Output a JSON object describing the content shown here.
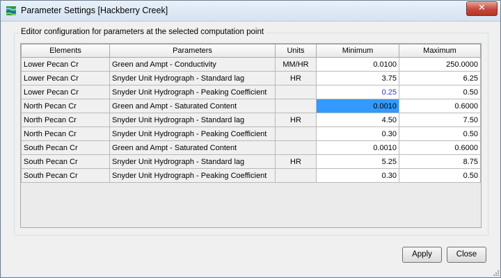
{
  "window": {
    "title": "Parameter Settings [Hackberry Creek]"
  },
  "group": {
    "label": "Editor configuration for parameters at the selected computation point"
  },
  "table": {
    "headers": [
      "Elements",
      "Parameters",
      "Units",
      "Minimum",
      "Maximum"
    ],
    "rows": [
      {
        "element": "Lower Pecan Cr",
        "parameter": "Green and Ampt - Conductivity",
        "units": "MM/HR",
        "minimum": "0.0100",
        "maximum": "250.0000"
      },
      {
        "element": "Lower Pecan Cr",
        "parameter": "Snyder Unit Hydrograph - Standard lag",
        "units": "HR",
        "minimum": "3.75",
        "maximum": "6.25"
      },
      {
        "element": "Lower Pecan Cr",
        "parameter": "Snyder Unit Hydrograph - Peaking Coefficient",
        "units": "",
        "minimum": "0.25",
        "maximum": "0.50"
      },
      {
        "element": "North Pecan Cr",
        "parameter": "Green and Ampt - Saturated Content",
        "units": "",
        "minimum": "0.0010",
        "maximum": "0.6000"
      },
      {
        "element": "North Pecan Cr",
        "parameter": "Snyder Unit Hydrograph - Standard lag",
        "units": "HR",
        "minimum": "4.50",
        "maximum": "7.50"
      },
      {
        "element": "North Pecan Cr",
        "parameter": "Snyder Unit Hydrograph - Peaking Coefficient",
        "units": "",
        "minimum": "0.30",
        "maximum": "0.50"
      },
      {
        "element": "South Pecan Cr",
        "parameter": "Green and Ampt - Saturated Content",
        "units": "",
        "minimum": "0.0010",
        "maximum": "0.6000"
      },
      {
        "element": "South Pecan Cr",
        "parameter": "Snyder Unit Hydrograph - Standard lag",
        "units": "HR",
        "minimum": "5.25",
        "maximum": "8.75"
      },
      {
        "element": "South Pecan Cr",
        "parameter": "Snyder Unit Hydrograph - Peaking Coefficient",
        "units": "",
        "minimum": "0.30",
        "maximum": "0.50"
      }
    ],
    "selected_cell": {
      "row": 3,
      "column": "minimum"
    },
    "edited_cell": {
      "row": 2,
      "column": "minimum"
    }
  },
  "buttons": {
    "apply": "Apply",
    "close": "Close"
  },
  "icons": {
    "app": "hec-hms-app-icon",
    "close": "close-icon"
  },
  "colors": {
    "selection": "#3399ff",
    "edited_value": "#2b35c8",
    "close_button": "#c4493a"
  }
}
